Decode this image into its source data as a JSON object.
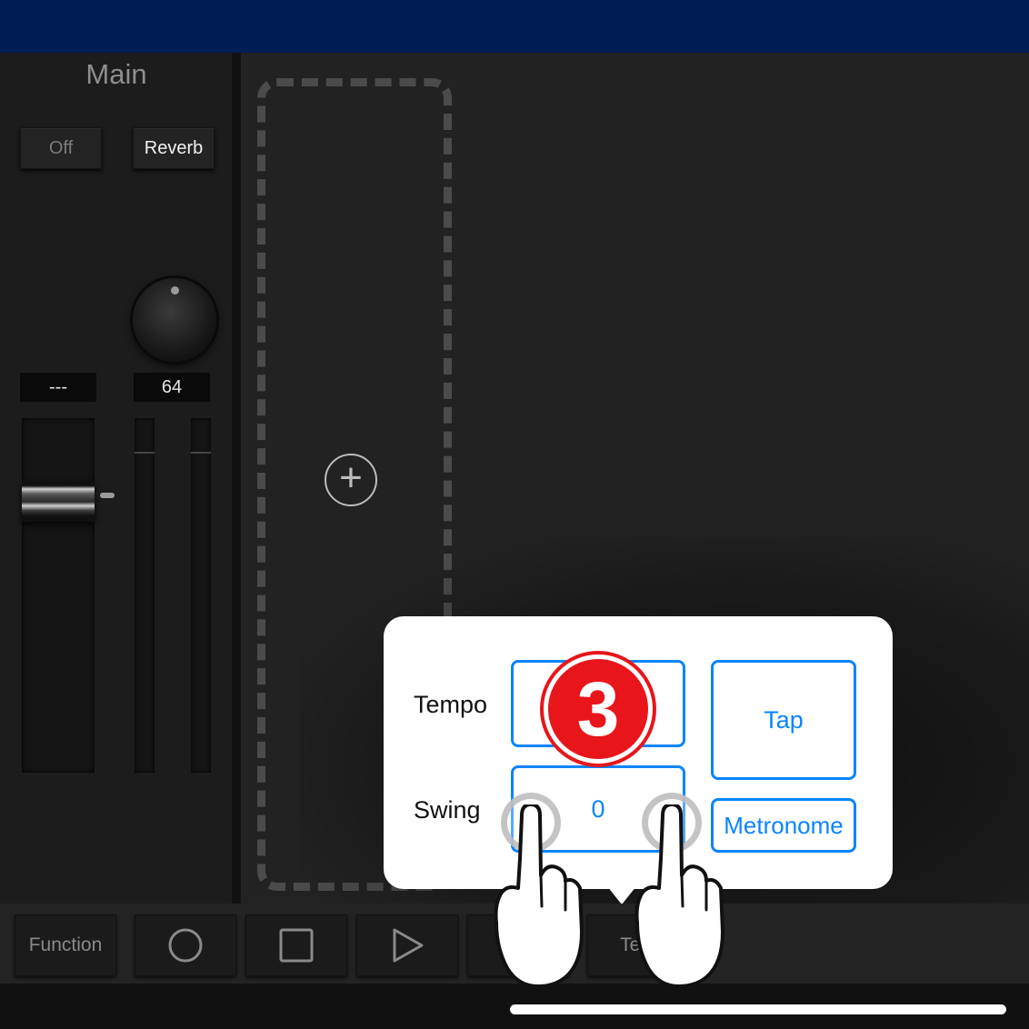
{
  "mixer": {
    "title": "Main",
    "off_label": "Off",
    "reverb_label": "Reverb",
    "left_value": "---",
    "right_value": "64"
  },
  "popover": {
    "tempo_label": "Tempo",
    "tempo_value": "",
    "swing_label": "Swing",
    "swing_value": "0",
    "tap_label": "Tap",
    "metronome_label": "Metronome"
  },
  "annotation": {
    "step_number": "3"
  },
  "toolbar": {
    "function_label": "Function",
    "tempo_label": "Tem"
  },
  "colors": {
    "accent": "#0a84ff",
    "badge": "#e8151a",
    "topbar": "#001c55"
  },
  "icons": {
    "add": "plus-circle-icon",
    "record": "record-icon",
    "stop": "stop-icon",
    "play": "play-icon",
    "loop": "loop-icon",
    "touch": "touch-point-icon",
    "hand": "pointing-hand-icon"
  }
}
